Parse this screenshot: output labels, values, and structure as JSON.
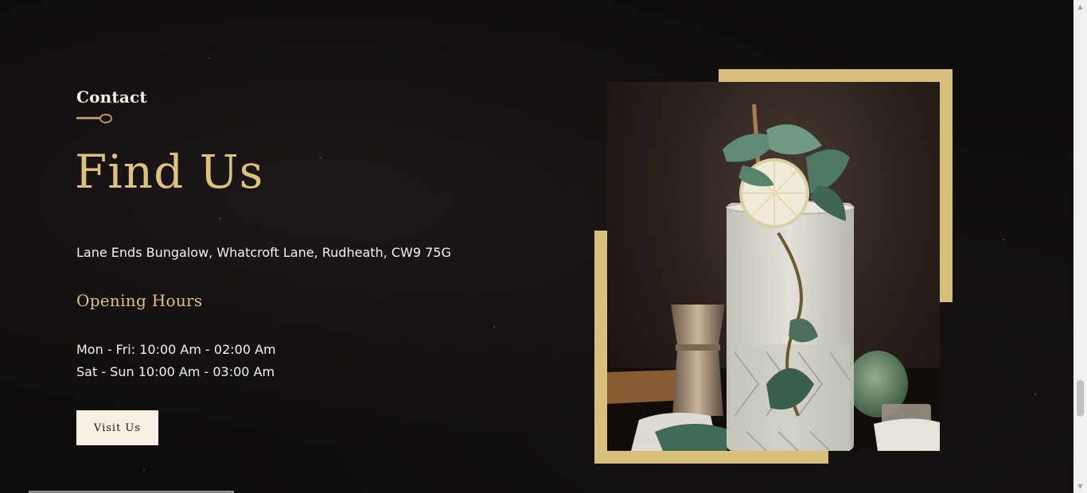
{
  "section": {
    "eyebrow": "Contact",
    "heading": "Find Us",
    "address": "Lane Ends Bungalow, Whatcroft Lane, Rudheath, CW9 75G",
    "hours_title": "Opening Hours",
    "hours": [
      "Mon - Fri: 10:00 Am - 02:00 Am",
      "Sat - Sun 10:00 Am - 03:00 Am"
    ],
    "button_label": "Visit Us"
  },
  "image": {
    "subject": "mojito-cocktail-photo"
  },
  "icons": {
    "divider": "spoon-icon",
    "scroll_up": "chevron-up-icon",
    "scroll_down": "chevron-down-icon"
  },
  "scrollbar": {
    "up_glyph": "▲",
    "down_glyph": "▼"
  },
  "colors": {
    "background": "#0f0c0d",
    "gold": "#dcc27d",
    "frame": "#d8c07c",
    "text": "#f4f0ea",
    "button_bg": "#f6efe2"
  }
}
